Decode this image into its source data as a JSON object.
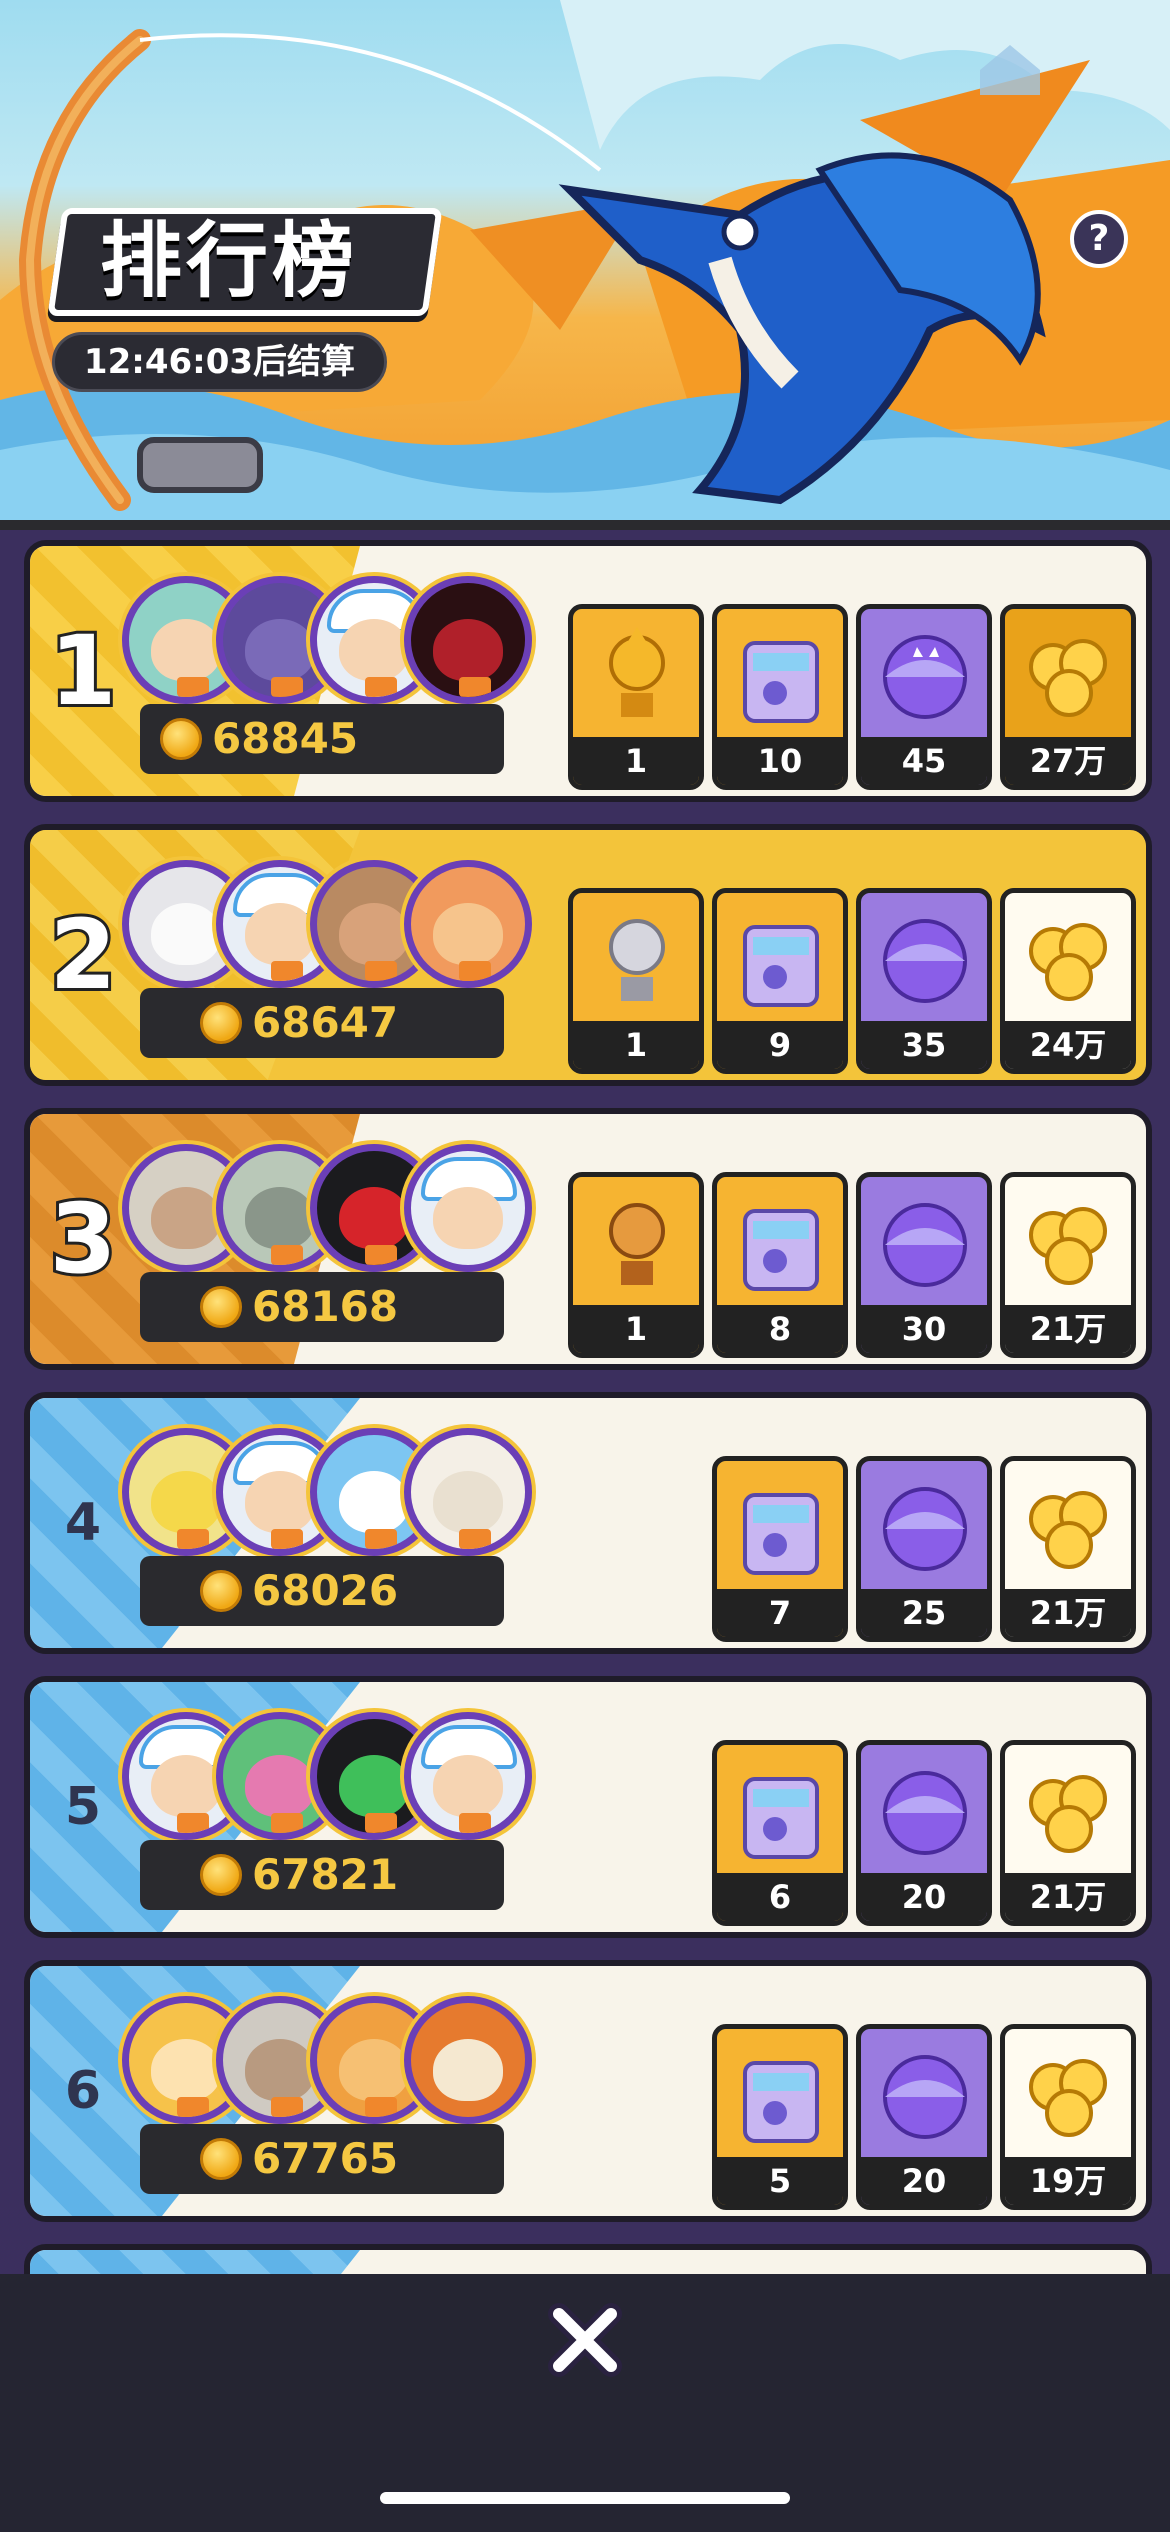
{
  "header": {
    "title": "排行榜",
    "countdown": "12:46:03后结算",
    "help_label": "?"
  },
  "rows": [
    {
      "rank": "1",
      "score": "68845",
      "rewards": [
        "1",
        "10",
        "45",
        "27万"
      ]
    },
    {
      "rank": "2",
      "score": "68647",
      "rewards": [
        "1",
        "9",
        "35",
        "24万"
      ]
    },
    {
      "rank": "3",
      "score": "68168",
      "rewards": [
        "1",
        "8",
        "30",
        "21万"
      ]
    },
    {
      "rank": "4",
      "score": "68026",
      "rewards": [
        "7",
        "25",
        "21万"
      ]
    },
    {
      "rank": "5",
      "score": "67821",
      "rewards": [
        "6",
        "20",
        "21万"
      ]
    },
    {
      "rank": "6",
      "score": "67765",
      "rewards": [
        "5",
        "20",
        "19万"
      ]
    }
  ],
  "reward_icons": [
    "trophy-icon",
    "mystery-box-icon",
    "cat-capsule-icon",
    "gold-coins-icon"
  ],
  "colors": {
    "background": "#3b2f5e",
    "gold_row": "#f3c43a",
    "score_text": "#f5c842",
    "bottom_bar": "#252532"
  }
}
